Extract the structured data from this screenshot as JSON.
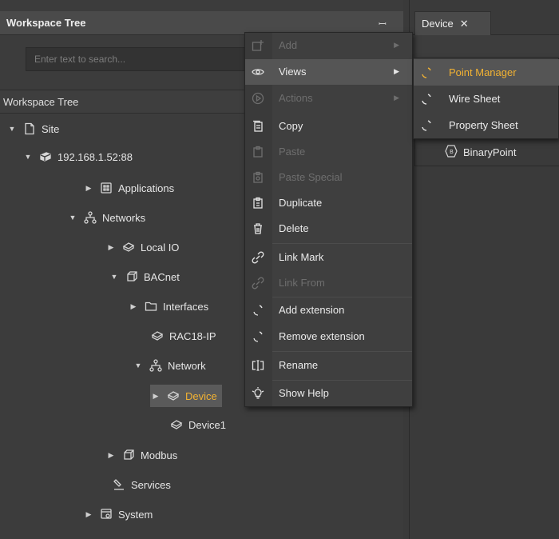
{
  "workspace": {
    "title": "Workspace Tree",
    "pin_icon": "pin-icon",
    "search_placeholder": "Enter text to search...",
    "tree_header": "Workspace Tree",
    "nodes": {
      "site": "Site",
      "host": "192.168.1.52:88",
      "applications": "Applications",
      "networks": "Networks",
      "local_io": "Local IO",
      "bacnet": "BACnet",
      "interfaces": "Interfaces",
      "rac18": "RAC18-IP",
      "network": "Network",
      "device": "Device",
      "device1": "Device1",
      "modbus": "Modbus",
      "services": "Services",
      "system": "System"
    }
  },
  "device_panel": {
    "tab_label": "Device",
    "tab_close": "✕",
    "item": "BinaryPoint"
  },
  "context_menu": {
    "add": "Add",
    "views": "Views",
    "actions": "Actions",
    "copy": "Copy",
    "paste": "Paste",
    "paste_special": "Paste Special",
    "duplicate": "Duplicate",
    "delete": "Delete",
    "link_mark": "Link Mark",
    "link_from": "Link From",
    "add_extension": "Add extension",
    "remove_extension": "Remove extension",
    "rename": "Rename",
    "show_help": "Show Help"
  },
  "views_submenu": {
    "point_manager": "Point Manager",
    "wire_sheet": "Wire Sheet",
    "property_sheet": "Property Sheet"
  },
  "colors": {
    "accent": "#f2b233",
    "panel_bg": "#3c3c3c",
    "menu_bg": "#3f3f3f",
    "highlight": "#555555"
  }
}
